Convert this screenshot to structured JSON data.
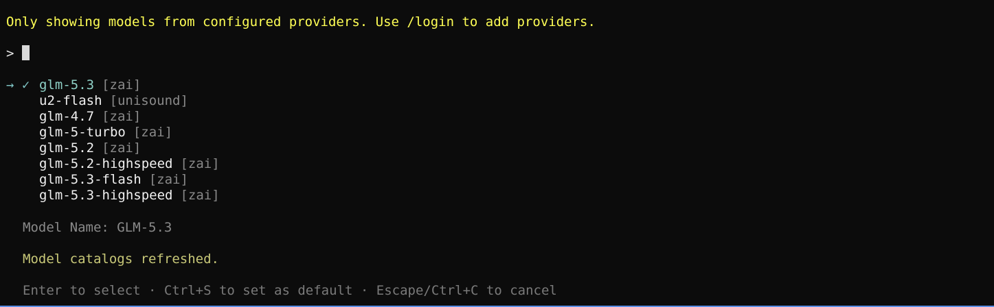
{
  "notice": "Only showing models from configured providers. Use /login to add providers.",
  "prompt": {
    "symbol": ">",
    "value": ""
  },
  "models": [
    {
      "marker": "→ ✓",
      "name": "glm-5.3",
      "provider": "[zai]",
      "selected": true
    },
    {
      "marker": "",
      "name": "u2-flash",
      "provider": "[unisound]",
      "selected": false
    },
    {
      "marker": "",
      "name": "glm-4.7",
      "provider": "[zai]",
      "selected": false
    },
    {
      "marker": "",
      "name": "glm-5-turbo",
      "provider": "[zai]",
      "selected": false
    },
    {
      "marker": "",
      "name": "glm-5.2",
      "provider": "[zai]",
      "selected": false
    },
    {
      "marker": "",
      "name": "glm-5.2-highspeed",
      "provider": "[zai]",
      "selected": false
    },
    {
      "marker": "",
      "name": "glm-5.3-flash",
      "provider": "[zai]",
      "selected": false
    },
    {
      "marker": "",
      "name": "glm-5.3-highspeed",
      "provider": "[zai]",
      "selected": false
    }
  ],
  "model_info": "Model Name: GLM-5.3",
  "status": "Model catalogs refreshed.",
  "hint": "Enter to select · Ctrl+S to set as default · Escape/Ctrl+C to cancel",
  "colors": {
    "background": "#0c0c0c",
    "notice": "#ffff55",
    "selected": "#8fd1c7",
    "provider": "#8a8a8a",
    "status": "#c8c878",
    "accent_bar": "#5b8ee6"
  }
}
